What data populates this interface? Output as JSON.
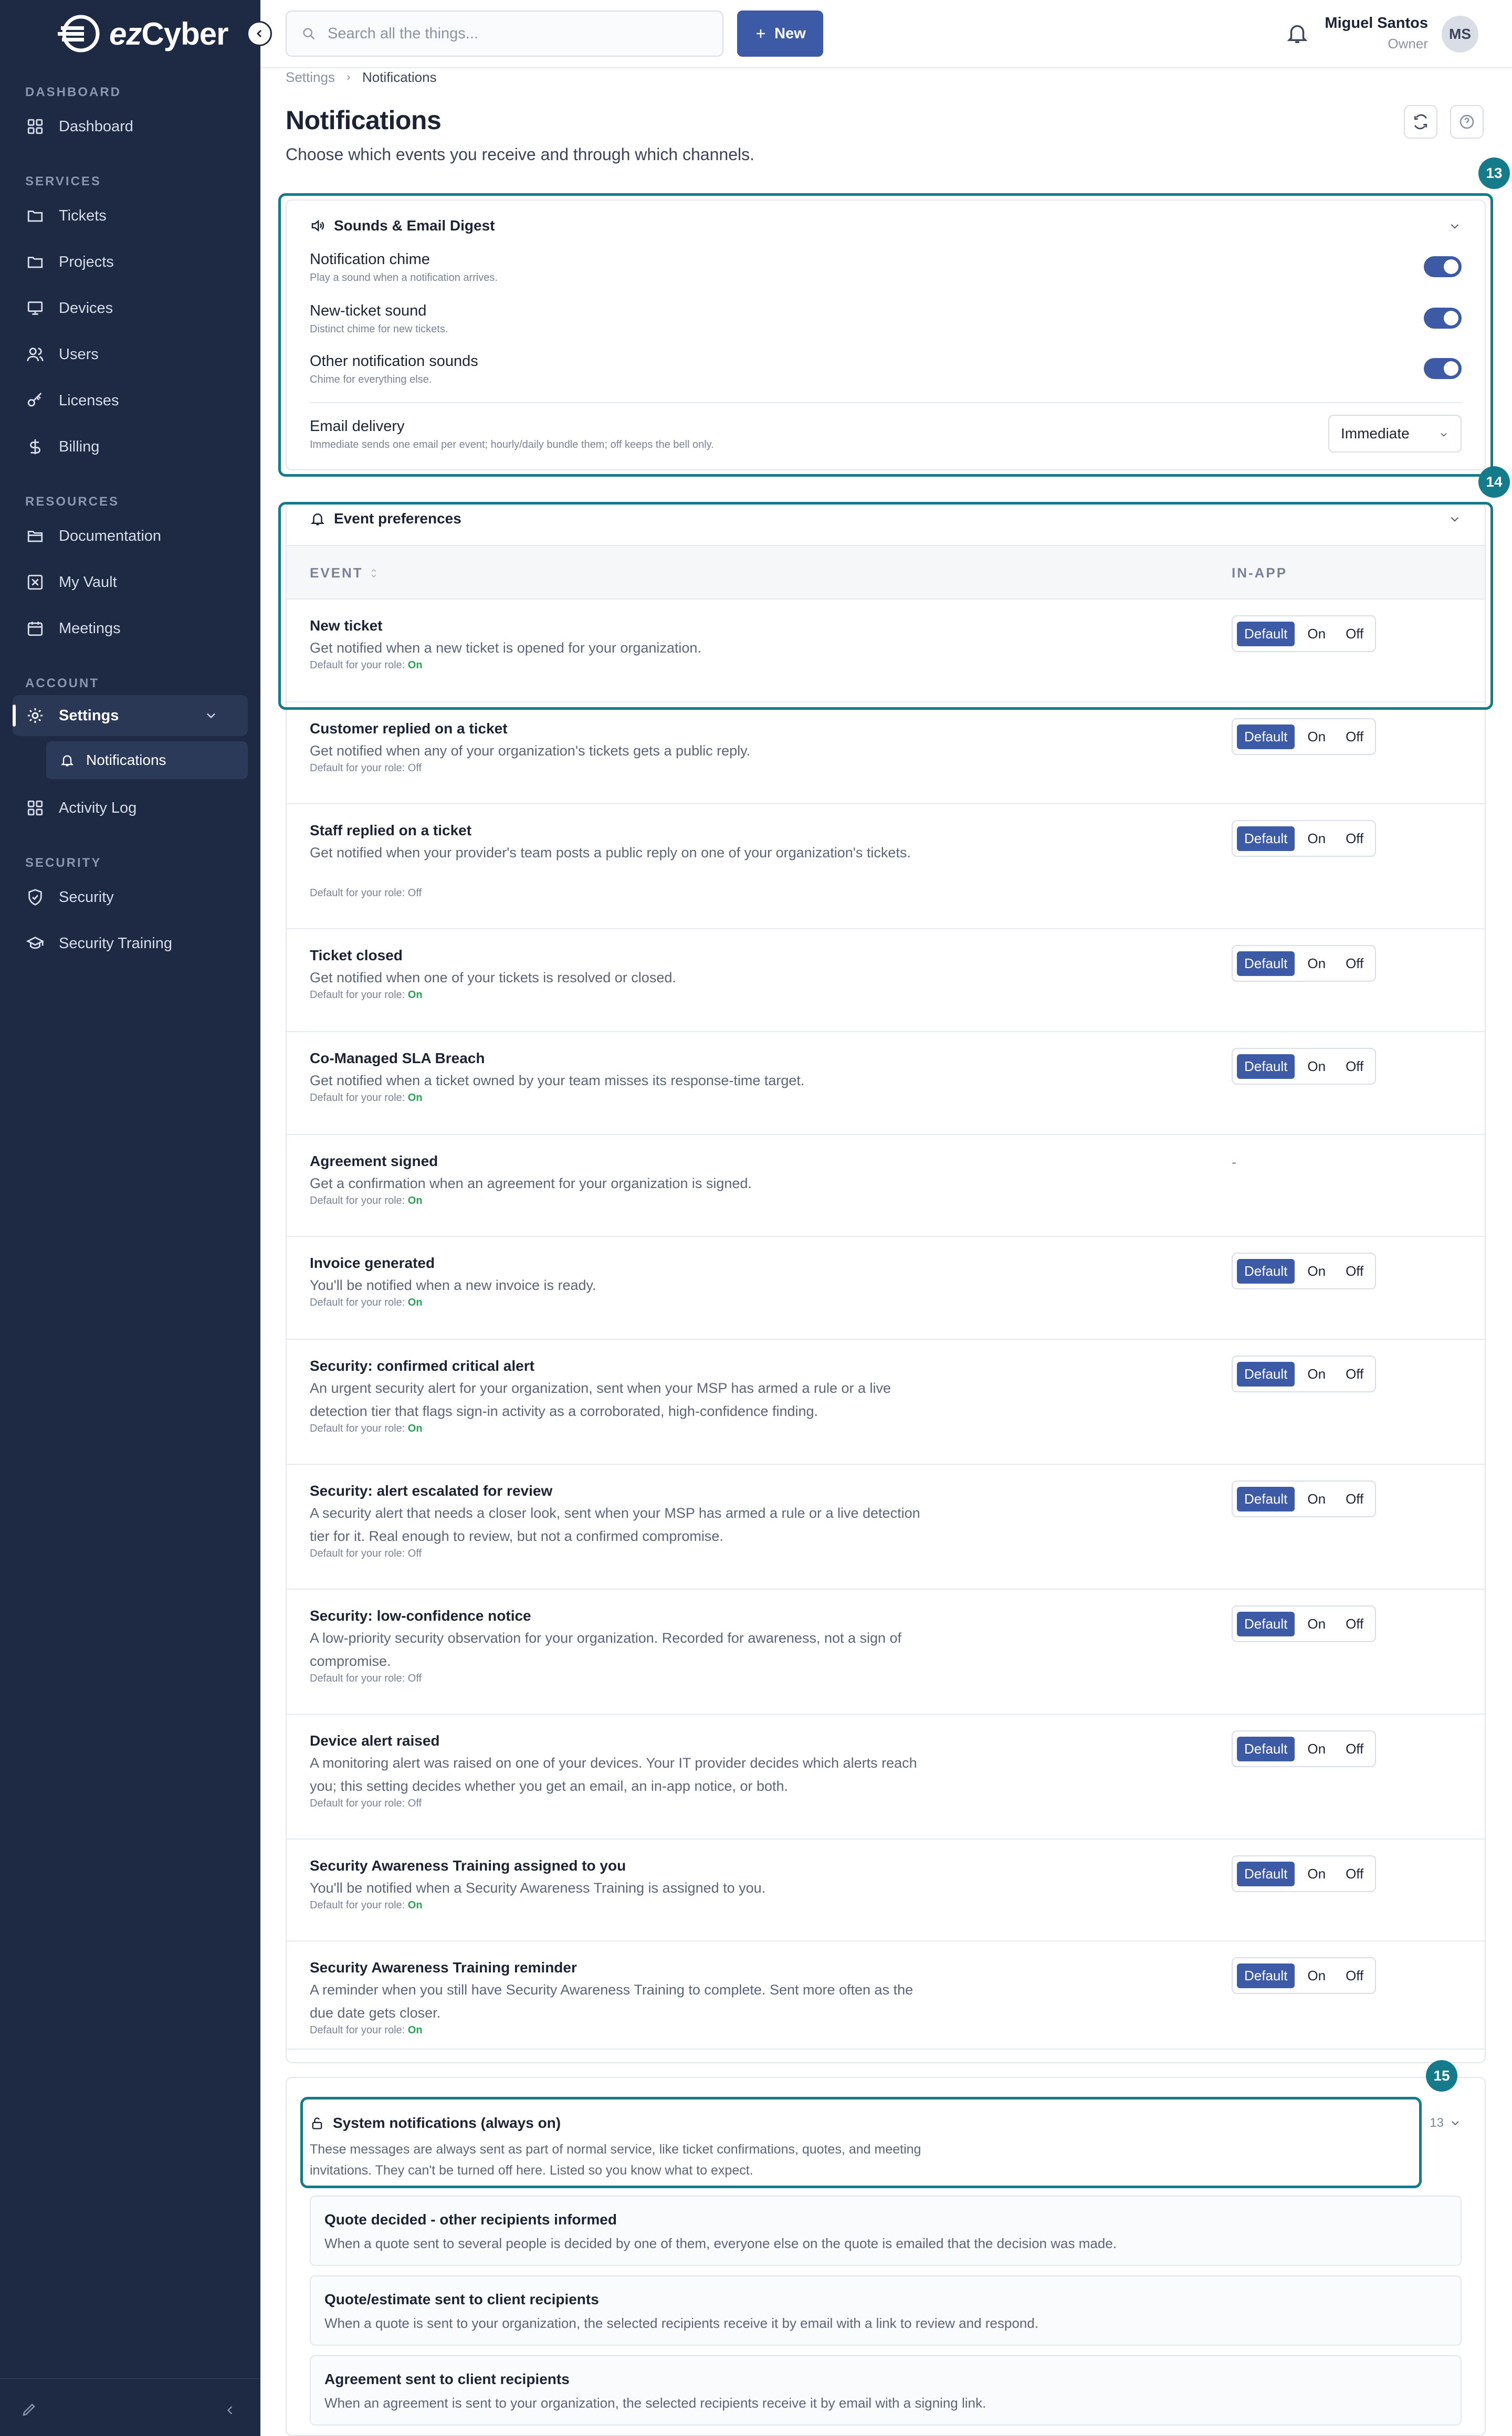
{
  "brand": {
    "name_part1": "ez",
    "name_part2": "Cyber"
  },
  "sidebar": {
    "sections": [
      {
        "label": "DASHBOARD"
      },
      {
        "label": "SERVICES"
      },
      {
        "label": "RESOURCES"
      },
      {
        "label": "ACCOUNT"
      },
      {
        "label": "SECURITY"
      }
    ],
    "items": [
      {
        "label": "Dashboard",
        "icon": "grid-icon"
      },
      {
        "label": "Tickets",
        "icon": "folder-icon"
      },
      {
        "label": "Projects",
        "icon": "folder-icon"
      },
      {
        "label": "Devices",
        "icon": "monitor-icon"
      },
      {
        "label": "Users",
        "icon": "users-icon"
      },
      {
        "label": "Licenses",
        "icon": "key-icon"
      },
      {
        "label": "Billing",
        "icon": "dollar-icon"
      },
      {
        "label": "Documentation",
        "icon": "folder-open-icon"
      },
      {
        "label": "My Vault",
        "icon": "vault-icon"
      },
      {
        "label": "Meetings",
        "icon": "calendar-icon"
      },
      {
        "label": "Settings",
        "icon": "gear-icon"
      },
      {
        "label": "Notifications",
        "icon": "bell-icon"
      },
      {
        "label": "Activity Log",
        "icon": "grid-icon"
      },
      {
        "label": "Security",
        "icon": "shield-icon"
      },
      {
        "label": "Security Training",
        "icon": "graduation-cap-icon"
      }
    ]
  },
  "topbar": {
    "search_placeholder": "Search all the things...",
    "new_label": "New",
    "user_name": "Miguel Santos",
    "user_role": "Owner",
    "user_initials": "MS"
  },
  "breadcrumb": {
    "parent": "Settings",
    "current": "Notifications"
  },
  "page": {
    "title": "Notifications",
    "subtitle": "Choose which events you receive and through which channels."
  },
  "markers": {
    "m13": "13",
    "m14": "14",
    "m15": "15"
  },
  "sounds": {
    "title": "Sounds & Email Digest",
    "rows": [
      {
        "title": "Notification chime",
        "sub": "Play a sound when a notification arrives."
      },
      {
        "title": "New-ticket sound",
        "sub": "Distinct chime for new tickets."
      },
      {
        "title": "Other notification sounds",
        "sub": "Chime for everything else."
      }
    ],
    "email_title": "Email delivery",
    "email_sub": "Immediate sends one email per event; hourly/daily bundle them; off keeps the bell only.",
    "email_value": "Immediate"
  },
  "events": {
    "title": "Event preferences",
    "col_event": "EVENT",
    "col_inapp": "IN-APP",
    "default_prefix": "Default for your role:",
    "seg_default": "Default",
    "seg_on": "On",
    "seg_off": "Off",
    "dash": "-",
    "rows": [
      {
        "name": "New ticket",
        "desc": "Get notified when a new ticket is opened for your organization.",
        "role": "On"
      },
      {
        "name": "Customer replied on a ticket",
        "desc": "Get notified when any of your organization's tickets gets a public reply.",
        "role": "Off"
      },
      {
        "name": "Staff replied on a ticket",
        "desc": "Get notified when your provider's team posts a public reply on one of your organization's tickets.",
        "role": "Off"
      },
      {
        "name": "Ticket closed",
        "desc": "Get notified when one of your tickets is resolved or closed.",
        "role": "On"
      },
      {
        "name": "Co-Managed SLA Breach",
        "desc": "Get notified when a ticket owned by your team misses its response-time target.",
        "role": "On"
      },
      {
        "name": "Agreement signed",
        "desc": "Get a confirmation when an agreement for your organization is signed.",
        "role": "On"
      },
      {
        "name": "Invoice generated",
        "desc": "You'll be notified when a new invoice is ready.",
        "role": "On"
      },
      {
        "name": "Security: confirmed critical alert",
        "desc": "An urgent security alert for your organization, sent when your MSP has armed a rule or a live detection tier that flags sign-in activity as a corroborated, high-confidence finding.",
        "role": "On"
      },
      {
        "name": "Security: alert escalated for review",
        "desc": "A security alert that needs a closer look, sent when your MSP has armed a rule or a live detection tier for it. Real enough to review, but not a confirmed compromise.",
        "role": "Off"
      },
      {
        "name": "Security: low-confidence notice",
        "desc": "A low-priority security observation for your organization. Recorded for awareness, not a sign of compromise.",
        "role": "Off"
      },
      {
        "name": "Device alert raised",
        "desc": "A monitoring alert was raised on one of your devices. Your IT provider decides which alerts reach you; this setting decides whether you get an email, an in-app notice, or both.",
        "role": "Off"
      },
      {
        "name": "Security Awareness Training assigned to you",
        "desc": "You'll be notified when a Security Awareness Training is assigned to you.",
        "role": "On"
      },
      {
        "name": "Security Awareness Training reminder",
        "desc": "A reminder when you still have Security Awareness Training to complete. Sent more often as the due date gets closer.",
        "role": "On"
      }
    ]
  },
  "system": {
    "title": "System notifications (always on)",
    "count": "13",
    "desc": "These messages are always sent as part of normal service, like ticket confirmations, quotes, and meeting invitations. They can't be turned off here. Listed so you know what to expect.",
    "items": [
      {
        "title": "Quote decided - other recipients informed",
        "desc": "When a quote sent to several people is decided by one of them, everyone else on the quote is emailed that the decision was made."
      },
      {
        "title": "Quote/estimate sent to client recipients",
        "desc": "When a quote is sent to your organization, the selected recipients receive it by email with a link to review and respond."
      },
      {
        "title": "Agreement sent to client recipients",
        "desc": "When an agreement is sent to your organization, the selected recipients receive it by email with a signing link."
      }
    ]
  },
  "colors": {
    "sidebar": "#1e2a44",
    "accent": "#3c5aa6",
    "highlight": "#147b8a",
    "on": "#2e9e58"
  }
}
